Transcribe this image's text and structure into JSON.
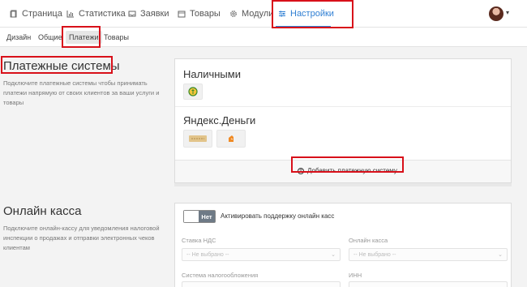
{
  "topnav": {
    "items": [
      {
        "label": "Страница",
        "icon": "page-icon"
      },
      {
        "label": "Статистика",
        "icon": "chart-icon"
      },
      {
        "label": "Заявки",
        "icon": "inbox-icon"
      },
      {
        "label": "Товары",
        "icon": "box-icon"
      },
      {
        "label": "Модули",
        "icon": "gear-icon"
      },
      {
        "label": "Настройки",
        "icon": "sliders-icon"
      }
    ],
    "active_item": "Настройки",
    "accent_color": "#2f7fd3"
  },
  "subnav": {
    "tabs": [
      {
        "label": "Дизайн"
      },
      {
        "label": "Общие"
      },
      {
        "label": "Платежи"
      },
      {
        "label": "Товары"
      }
    ],
    "active_tab": "Платежи"
  },
  "payments": {
    "title": "Платежные системы",
    "description": "Подключите платежные системы чтобы принимать платежи напрямую от своих клиентов за ваши услуги и товары",
    "systems": [
      {
        "name": "Наличными",
        "icons": [
          "cash-icon"
        ]
      },
      {
        "name": "Яндекс.Деньги",
        "icons": [
          "card-icon",
          "wallet-icon"
        ]
      }
    ],
    "add_button": "Добавить платежную систему"
  },
  "cashbox": {
    "title": "Онлайн касса",
    "description": "Подключите онлайн-кассу для уведомления налоговой инспекции о продажах и отправки электронных чеков клиентам",
    "toggle_state": "Нет",
    "toggle_label": "Активировать поддержку онлайн касс",
    "fields": {
      "vat_label": "Ставка НДС",
      "vat_value": "-- Не выбрано --",
      "cashbox_label": "Онлайн касса",
      "cashbox_value": "-- Не выбрано --",
      "tax_label": "Система налогообложения",
      "inn_label": "ИНН"
    }
  },
  "highlight_color": "#d8101a"
}
